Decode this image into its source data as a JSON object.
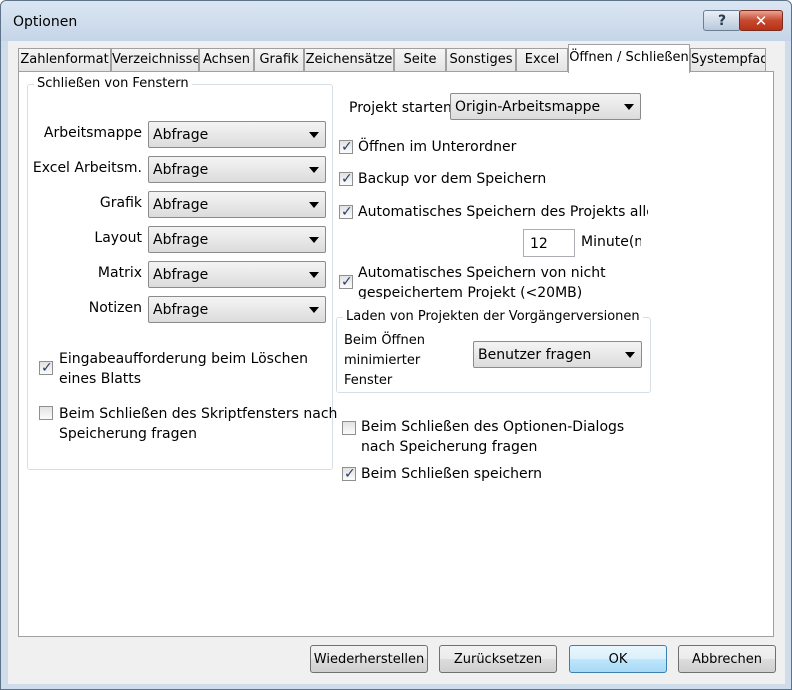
{
  "window": {
    "title": "Optionen",
    "help_glyph": "?",
    "close_glyph": "✕"
  },
  "tabs": [
    {
      "label": "Zahlenformat"
    },
    {
      "label": "Verzeichnisse"
    },
    {
      "label": "Achsen"
    },
    {
      "label": "Grafik"
    },
    {
      "label": "Zeichensätze"
    },
    {
      "label": "Seite"
    },
    {
      "label": "Sonstiges"
    },
    {
      "label": "Excel"
    },
    {
      "label": "Öffnen / Schließen",
      "active": true
    },
    {
      "label": "Systempfad"
    }
  ],
  "close_windows_group": {
    "title": "Schließen von Fenstern",
    "rows": [
      {
        "label": "Arbeitsmappe",
        "value": "Abfrage"
      },
      {
        "label": "Excel Arbeitsm.",
        "value": "Abfrage"
      },
      {
        "label": "Grafik",
        "value": "Abfrage"
      },
      {
        "label": "Layout",
        "value": "Abfrage"
      },
      {
        "label": "Matrix",
        "value": "Abfrage"
      },
      {
        "label": "Notizen",
        "value": "Abfrage"
      }
    ],
    "checkboxes": [
      {
        "label_line1": "Eingabeaufforderung beim Löschen",
        "label_line2": "eines Blatts",
        "checked": true
      },
      {
        "label_line1": "Beim Schließen des Skriptfensters nach",
        "label_line2": "Speicherung fragen",
        "checked": false
      }
    ]
  },
  "project_start": {
    "label": "Projekt starten",
    "value": "Origin-Arbeitsmappe"
  },
  "right_options": {
    "open_in_subfolder": {
      "label": "Öffnen im Unterordner",
      "checked": true
    },
    "backup_before_save": {
      "label": "Backup vor dem Speichern",
      "checked": true
    },
    "autosave_project": {
      "label": "Automatisches Speichern des Projekts alle",
      "checked": true
    },
    "autosave_interval": {
      "value": "12",
      "unit": "Minute(n)"
    },
    "autosave_unsaved": {
      "label_line1": "Automatisches Speichern von nicht",
      "label_line2": "gespeichertem Projekt (<20MB)",
      "checked": true
    }
  },
  "legacy_group": {
    "title": "Laden von Projekten der Vorgängerversionen",
    "label_line1": "Beim Öffnen",
    "label_line2": "minimierter",
    "label_line3": "Fenster",
    "value": "Benutzer fragen"
  },
  "bottom_checks": {
    "ask_on_close": {
      "label_line1": "Beim Schließen des Optionen-Dialogs",
      "label_line2": "nach Speicherung fragen",
      "checked": false
    },
    "save_on_close": {
      "label": "Beim Schließen speichern",
      "checked": true
    }
  },
  "buttons": {
    "restore": "Wiederherstellen",
    "reset": "Zurücksetzen",
    "ok": "OK",
    "cancel": "Abbrechen"
  },
  "check_glyph": "✓",
  "colors": {
    "frame": "#cfdcea",
    "close_button": "#c6492f",
    "default_button": "#a7d9f5"
  }
}
